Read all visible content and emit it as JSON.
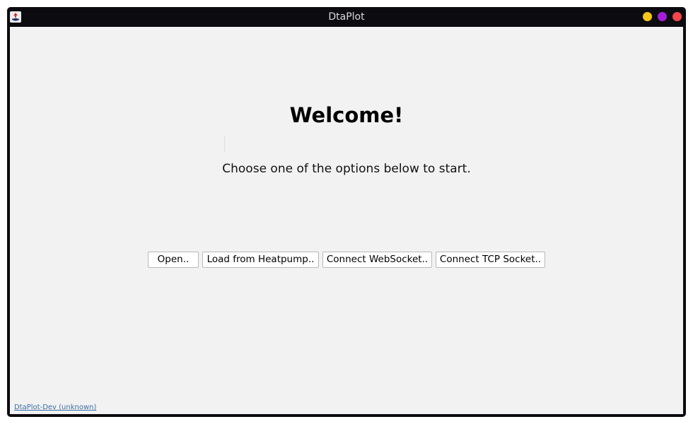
{
  "window": {
    "title": "DtaPlot",
    "controls": {
      "minimize_color": "#f5c518",
      "maximize_color": "#a51ed6",
      "close_color": "#f2464a"
    }
  },
  "main": {
    "heading": "Welcome!",
    "subtitle": "Choose one of the options below to start.",
    "buttons": [
      {
        "label": "Open.."
      },
      {
        "label": "Load from Heatpump.."
      },
      {
        "label": "Connect WebSocket.."
      },
      {
        "label": "Connect TCP Socket.."
      }
    ]
  },
  "footer": {
    "version_link": "DtaPlot-Dev (unknown)"
  },
  "icons": {
    "app": "java-app-icon"
  }
}
